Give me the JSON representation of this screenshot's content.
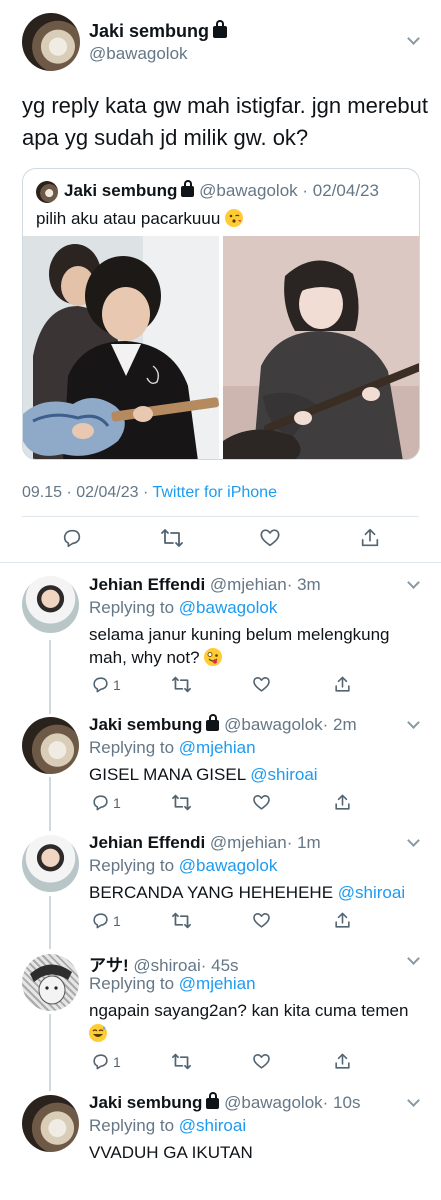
{
  "main_tweet": {
    "author_name": "Jaki sembung",
    "author_handle": "@bawagolok",
    "text": "yg reply kata gw mah istigfar. jgn merebut apa yg sudah jd milik gw. ok?",
    "quoted": {
      "author_name": "Jaki sembung",
      "author_handle": "@bawagolok",
      "date": "· 02/04/23",
      "text": "pilih aku atau pacarkuuu"
    },
    "time": "09.15 · 02/04/23 · ",
    "source": "Twitter for iPhone"
  },
  "replies": [
    {
      "author_name": "Jehian Effendi",
      "author_handle": "@mjehian",
      "age": "· 3m",
      "replying_label": "Replying to ",
      "replying_to": "@bawagolok",
      "text": "selama janur kuning belum melengkung mah, why not?",
      "reply_count": "1"
    },
    {
      "author_name": "Jaki sembung",
      "author_handle": "@bawagolok",
      "age": "· 2m",
      "replying_label": "Replying to ",
      "replying_to": "@mjehian",
      "text": "GISEL MANA GISEL ",
      "mention": "@shiroai",
      "reply_count": "1"
    },
    {
      "author_name": "Jehian Effendi",
      "author_handle": "@mjehian",
      "age": "· 1m",
      "replying_label": "Replying to ",
      "replying_to": "@bawagolok",
      "text": "BERCANDA YANG HEHEHEHE ",
      "mention": "@shiroai",
      "reply_count": "1"
    },
    {
      "author_name": "アサ!",
      "author_handle": "@shiroai",
      "age": "· 45s",
      "replying_label": "Replying to ",
      "replying_to": "@mjehian",
      "text": "ngapain sayang2an? kan kita cuma temen",
      "reply_count": "1"
    },
    {
      "author_name": "Jaki sembung",
      "author_handle": "@bawagolok",
      "age": "· 10s",
      "replying_label": "Replying to ",
      "replying_to": "@shiroai",
      "text": "VVADUH GA IKUTAN"
    }
  ],
  "colors": {
    "link": "#1d9bf0",
    "muted": "#657786",
    "text": "#0f1419"
  },
  "icons": [
    "lock-icon",
    "chevron-down-icon",
    "reply-icon",
    "retweet-icon",
    "like-icon",
    "share-icon"
  ]
}
